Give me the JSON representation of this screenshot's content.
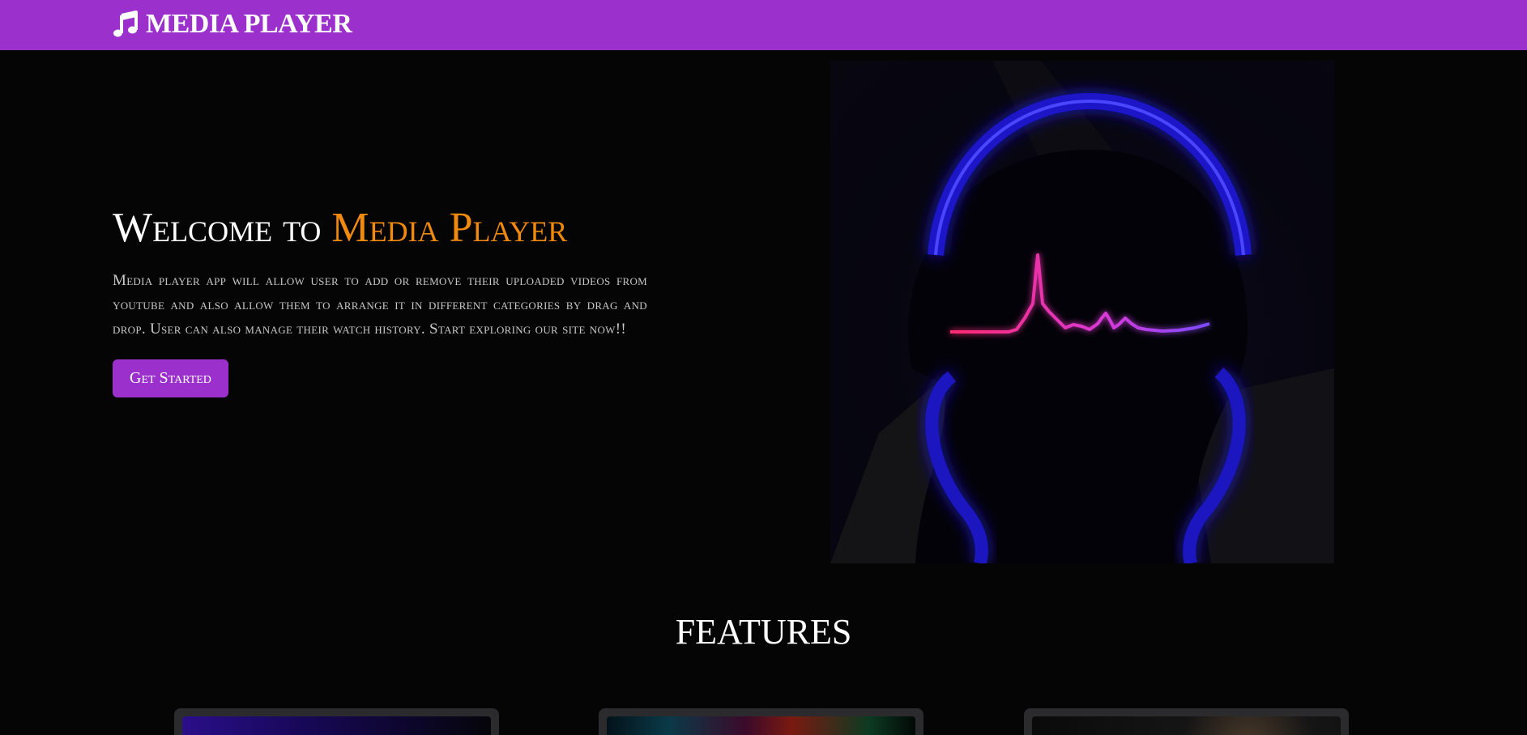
{
  "navbar": {
    "brand_icon": "music-note-icon",
    "brand_label": "MEDIA PLAYER",
    "background_color": "#9b30cc"
  },
  "hero": {
    "title_prefix": "Welcome to ",
    "title_accent": "Media Player",
    "accent_color": "#f08a0e",
    "description": "Media player app will allow user to add or remove their uploaded videos from youtube and also allow them to arrange it in different categories by drag and drop. User can also manage their watch history. Start exploring our site now!!",
    "cta_label": "Get Started",
    "image": "headphones-heartbeat-illustration"
  },
  "features": {
    "title": "FEATURES",
    "cards": [
      {
        "image": "feature-thumbnail"
      },
      {
        "image": "feature-thumbnail"
      },
      {
        "image": "feature-thumbnail"
      }
    ]
  }
}
